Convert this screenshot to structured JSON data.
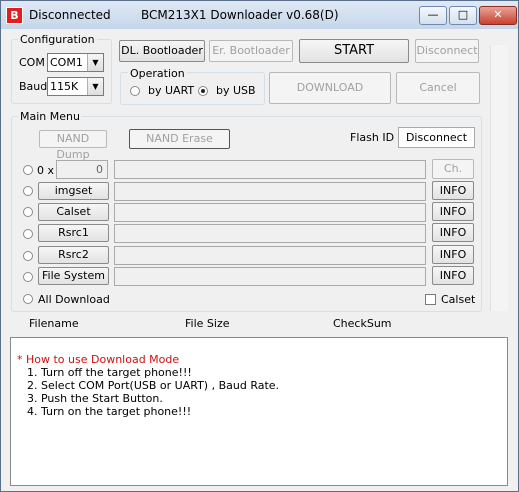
{
  "window": {
    "status": "Disconnected",
    "title": "BCM213X1 Downloader v0.68(D)",
    "icon_letter": "B",
    "minimize": "—",
    "maximize": "□",
    "close": "✕"
  },
  "config": {
    "label": "Configuration",
    "com_label": "COM",
    "com_value": "COM1",
    "baud_label": "Baud",
    "baud_value": "115K"
  },
  "top_buttons": {
    "dl_bootloader": "DL. Bootloader",
    "er_bootloader": "Er. Bootloader",
    "start": "START",
    "disconnect": "Disconnect",
    "download": "DOWNLOAD",
    "cancel": "Cancel"
  },
  "operation": {
    "label": "Operation",
    "uart": "by UART",
    "usb": "by USB",
    "selected": "usb"
  },
  "main_menu": {
    "label": "Main Menu",
    "nand_dump": "NAND Dump",
    "nand_erase": "NAND Erase",
    "flash_id_label": "Flash ID",
    "flash_id_value": "Disconnect"
  },
  "rows": {
    "hex_prefix": "0 x",
    "hex_value": "0",
    "ch_file": "Ch. File",
    "items": [
      {
        "label": "imgset",
        "info": "INFO"
      },
      {
        "label": "Calset",
        "info": "INFO"
      },
      {
        "label": "Rsrc1",
        "info": "INFO"
      },
      {
        "label": "Rsrc2",
        "info": "INFO"
      },
      {
        "label": "File System",
        "info": "INFO"
      }
    ],
    "all_download": "All Download",
    "calset_check": "Calset"
  },
  "file_table": {
    "columns": [
      "Filename",
      "File Size",
      "CheckSum"
    ]
  },
  "help": {
    "heading": "* How to use Download Mode",
    "steps": [
      "1. Turn off the target phone!!!",
      "2. Select COM Port(USB or UART) , Baud Rate.",
      "3. Push the Start Button.",
      "4. Turn on the target phone!!!"
    ],
    "heading_color": "#d01010"
  }
}
